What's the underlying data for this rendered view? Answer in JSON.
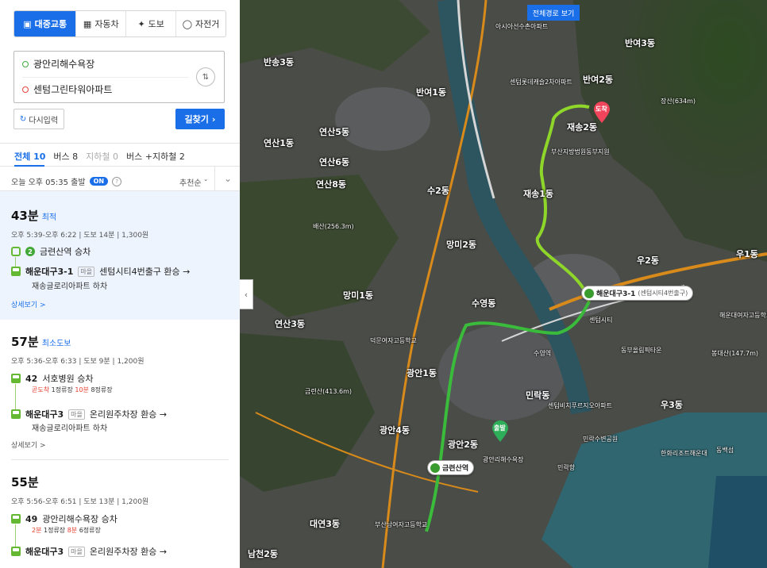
{
  "modes": [
    {
      "label": "대중교통",
      "icon": "bus-icon",
      "active": true
    },
    {
      "label": "자동차",
      "icon": "car-icon",
      "active": false
    },
    {
      "label": "도보",
      "icon": "walk-icon",
      "active": false
    },
    {
      "label": "자전거",
      "icon": "bike-icon",
      "active": false
    }
  ],
  "route": {
    "origin": "광안리해수욕장",
    "destination": "센텀그린타워아파트"
  },
  "buttons": {
    "reset": "다시입력",
    "search": "길찾기"
  },
  "filters": [
    {
      "label": "전체",
      "count": "10"
    },
    {
      "label": "버스",
      "count": "8"
    },
    {
      "label": "지하철",
      "count": "0"
    },
    {
      "label": "버스 +지하철",
      "count": "2"
    }
  ],
  "departure": {
    "text": "오늘 오후 05:35 출발",
    "toggle": "ON",
    "sort": "추천순"
  },
  "results": [
    {
      "duration": "43분",
      "tag": "최적",
      "meta": "오후 5:39-오후 6:22  |  도보 14분  |  1,300원",
      "steps": [
        {
          "line": "2",
          "text": "금련산역 승차"
        },
        {
          "bus": "해운대구3-1",
          "badge": "마을",
          "text": "센텀시티4번출구 환승 →",
          "sub": "재송글로리아파트 하차"
        }
      ],
      "more": "상세보기 >"
    },
    {
      "duration": "57분",
      "tag": "최소도보",
      "meta": "오후 5:36-오후 6:33  |  도보 9분  |  1,200원",
      "steps": [
        {
          "bus": "42",
          "text": "서호병원 승차",
          "warn1": "곧도착",
          "info1": "1정류장",
          "warn2": "10분",
          "info2": "8정류장"
        },
        {
          "bus": "해운대구3",
          "badge": "마을",
          "text": "온리원주차장 환승 →",
          "sub": "재송글로리아파트 하차"
        }
      ],
      "more": "상세보기 >"
    },
    {
      "duration": "55분",
      "tag": "",
      "meta": "오후 5:56-오후 6:51  |  도보 13분  |  1,200원",
      "steps": [
        {
          "bus": "49",
          "text": "광안리해수욕장 승차",
          "warn1": "2분",
          "info1": "1정류장",
          "warn2": "8분",
          "info2": "6정류장"
        },
        {
          "bus": "해운대구3",
          "badge": "마을",
          "text": "온리원주차장 환승 →"
        }
      ]
    }
  ],
  "map": {
    "fullview": "전체경로 보기",
    "start_label": "출발",
    "end_label": "도착",
    "station_pill": "금련산역",
    "bus_pill": "해운대구3-1",
    "bus_pill_sub": "(센텀시티4번출구)",
    "labels": [
      "반여3동",
      "반여2동",
      "재송2동",
      "재송1동",
      "우2동",
      "우1동",
      "반송3동",
      "반여1동",
      "망미2동",
      "망미1동",
      "연산3동",
      "연산6동",
      "민락동",
      "광안2동",
      "광안4동",
      "수영동",
      "우3동",
      "수2동",
      "대연3동",
      "남천2동",
      "광안1동",
      "연산8동",
      "연산1동",
      "연산5동"
    ],
    "pois": [
      "장산(634m)",
      "센텀롯데캐슬2차아파트",
      "부산지방법원동부지원",
      "센텀비치푸르지오아파트",
      "민락수변공원",
      "한화리조트해운대",
      "동백섬",
      "해운대여자고등학교",
      "봉대산(147.7m)",
      "배산(256.3m)",
      "금련산(413.6m)",
      "덕문여자고등학교",
      "센텀시티",
      "민락항",
      "부산남여자고등학교",
      "광안리해수욕장",
      "수영역",
      "동부올림픽타운",
      "아시아선수촌아파트"
    ]
  }
}
